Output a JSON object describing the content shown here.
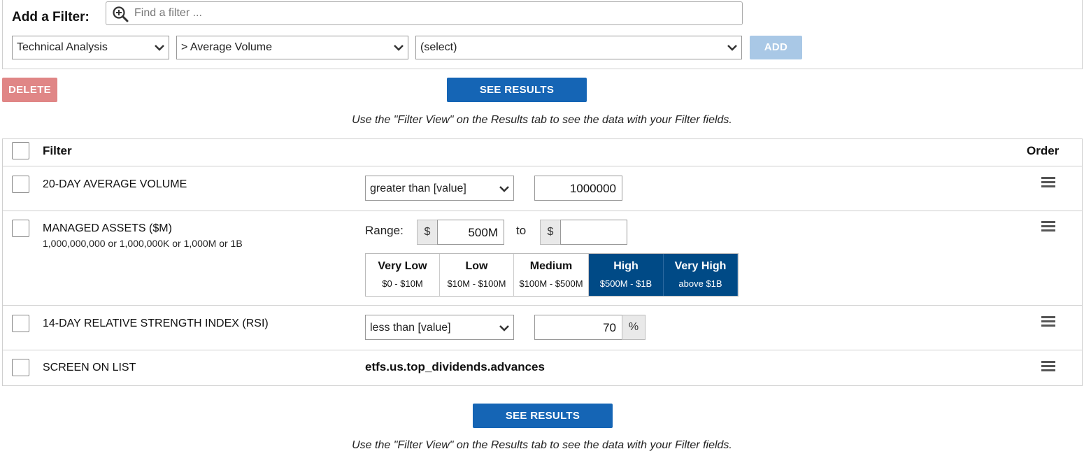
{
  "add_filter": {
    "label": "Add a Filter:",
    "search_placeholder": "Find a filter ...",
    "category_select": "Technical Analysis",
    "field_select": "> Average Volume",
    "option_select": "(select)",
    "add_button": "ADD"
  },
  "actions": {
    "delete_button": "DELETE",
    "see_results_button": "SEE RESULTS",
    "hint": "Use the \"Filter View\" on the Results tab to see the data with your Filter fields."
  },
  "table": {
    "header_filter": "Filter",
    "header_order": "Order",
    "rows": [
      {
        "name": "20-DAY AVERAGE VOLUME",
        "operator": "greater than [value]",
        "value": "1000000"
      },
      {
        "name": "MANAGED ASSETS ($M)",
        "subtitle": "1,000,000,000 or 1,000,000K or 1,000M or 1B",
        "range_label": "Range:",
        "currency": "$",
        "from_value": "500M",
        "to_label": "to",
        "to_value": "",
        "ranges": [
          {
            "title": "Very Low",
            "sub": "$0 - $10M",
            "selected": false
          },
          {
            "title": "Low",
            "sub": "$10M - $100M",
            "selected": false
          },
          {
            "title": "Medium",
            "sub": "$100M - $500M",
            "selected": false
          },
          {
            "title": "High",
            "sub": "$500M - $1B",
            "selected": true
          },
          {
            "title": "Very High",
            "sub": "above $1B",
            "selected": true
          }
        ]
      },
      {
        "name": "14-DAY RELATIVE STRENGTH INDEX (RSI)",
        "operator": "less than [value]",
        "value": "70",
        "unit": "%"
      },
      {
        "name": "SCREEN ON LIST",
        "list": "etfs.us.top_dividends.advances"
      }
    ]
  },
  "colors": {
    "primary": "#1565b5",
    "add_disabled": "#a9c8e6",
    "delete": "#e08686",
    "range_selected": "#004a86"
  }
}
